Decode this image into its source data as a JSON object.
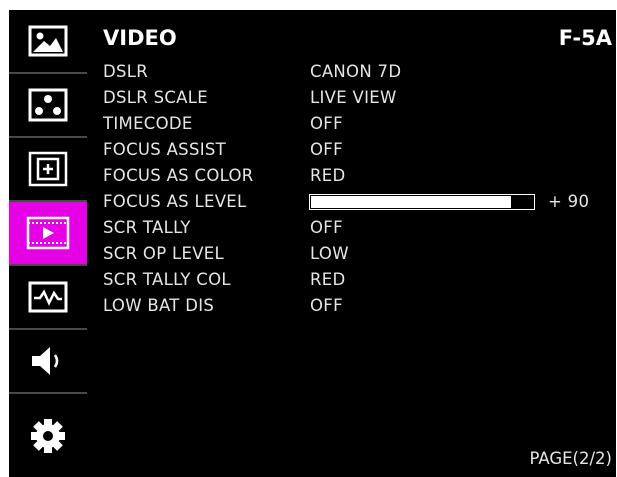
{
  "header": {
    "title": "VIDEO",
    "model": "F-5A"
  },
  "sidebar": {
    "items": [
      {
        "name": "picture",
        "icon": "picture-icon",
        "active": false
      },
      {
        "name": "dots",
        "icon": "dots-icon",
        "active": false
      },
      {
        "name": "marker",
        "icon": "marker-icon",
        "active": false
      },
      {
        "name": "video",
        "icon": "video-icon",
        "active": true
      },
      {
        "name": "waveform",
        "icon": "waveform-icon",
        "active": false
      },
      {
        "name": "audio",
        "icon": "speaker-icon",
        "active": false
      },
      {
        "name": "settings",
        "icon": "gear-icon",
        "active": false
      }
    ],
    "active_color": "#e600e6"
  },
  "menu": {
    "rows": [
      {
        "label": "DSLR",
        "value": "CANON 7D"
      },
      {
        "label": "DSLR SCALE",
        "value": "LIVE VIEW"
      },
      {
        "label": "TIMECODE",
        "value": "OFF"
      },
      {
        "label": "FOCUS ASSIST",
        "value": "OFF"
      },
      {
        "label": "FOCUS AS COLOR",
        "value": "RED"
      },
      {
        "label": "FOCUS AS LEVEL",
        "level": 90,
        "level_text": "+ 90"
      },
      {
        "label": "SCR TALLY",
        "value": "OFF"
      },
      {
        "label": "SCR OP LEVEL",
        "value": "LOW"
      },
      {
        "label": "SCR TALLY COL",
        "value": "RED"
      },
      {
        "label": "LOW BAT DIS",
        "value": "OFF"
      }
    ]
  },
  "footer": {
    "page": "PAGE(2/2)"
  }
}
